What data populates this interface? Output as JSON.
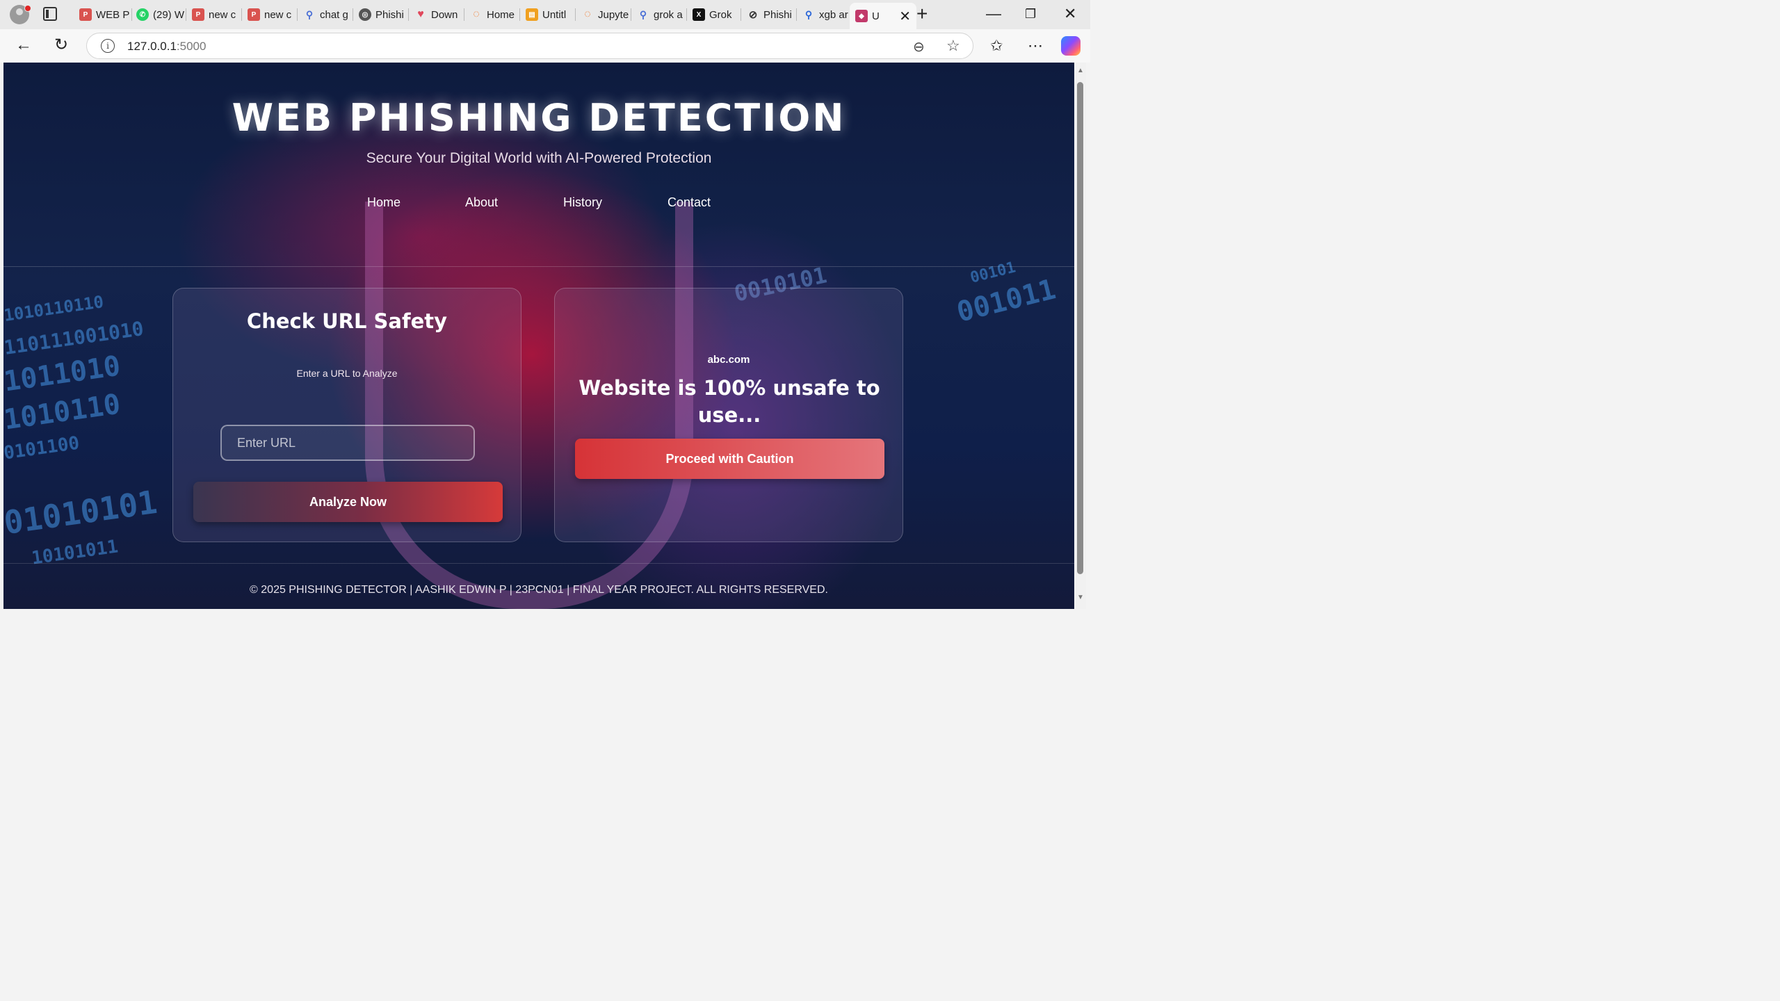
{
  "browser": {
    "tabs": [
      {
        "icon": "pdf-icon",
        "label": "WEB P",
        "color": "#d9534f"
      },
      {
        "icon": "whatsapp-icon",
        "label": "(29) W",
        "color": "#25d366"
      },
      {
        "icon": "pdf-icon",
        "label": "new c",
        "color": "#d9534f"
      },
      {
        "icon": "pdf-icon",
        "label": "new c",
        "color": "#d9534f"
      },
      {
        "icon": "search-icon",
        "label": "chat g",
        "color": "#4a6fd6"
      },
      {
        "icon": "openai-icon",
        "label": "Phishi",
        "color": "#555555"
      },
      {
        "icon": "heart-icon",
        "label": "Down",
        "color": "#e0475b"
      },
      {
        "icon": "jupyter-icon",
        "label": "Home",
        "color": "#f37626"
      },
      {
        "icon": "notebook-icon",
        "label": "Untitl",
        "color": "#f0a020"
      },
      {
        "icon": "jupyter-icon",
        "label": "Jupyte",
        "color": "#f37626"
      },
      {
        "icon": "search-icon",
        "label": "grok a",
        "color": "#4a6fd6"
      },
      {
        "icon": "x-grok-icon",
        "label": "Grok",
        "color": "#111111"
      },
      {
        "icon": "openai-icon",
        "label": "Phishi",
        "color": "#555555"
      },
      {
        "icon": "search-icon",
        "label": "xgb ar",
        "color": "#2a66d9"
      },
      {
        "icon": "app-icon",
        "label": "U",
        "color": "#c23a6b"
      }
    ],
    "address": {
      "host": "127.0.0.1",
      "port": ":5000"
    }
  },
  "site": {
    "title": "WEB PHISHING DETECTION",
    "tagline": "Secure Your Digital World with AI-Powered Protection",
    "nav": [
      "Home",
      "About",
      "History",
      "Contact"
    ]
  },
  "check_card": {
    "title": "Check URL Safety",
    "subtitle": "Enter a URL to Analyze",
    "input_placeholder": "Enter URL",
    "input_value": "",
    "button_label": "Analyze Now"
  },
  "result_card": {
    "url": "abc.com",
    "message": "Website is 100% unsafe to use...",
    "button_label": "Proceed with Caution"
  },
  "footer": "© 2025 PHISHING DETECTOR | AASHIK EDWIN P | 23PCN01 | FINAL YEAR PROJECT. ALL RIGHTS RESERVED.",
  "colors": {
    "accent_red": "#d63a3a",
    "background_navy": "#13234b"
  }
}
